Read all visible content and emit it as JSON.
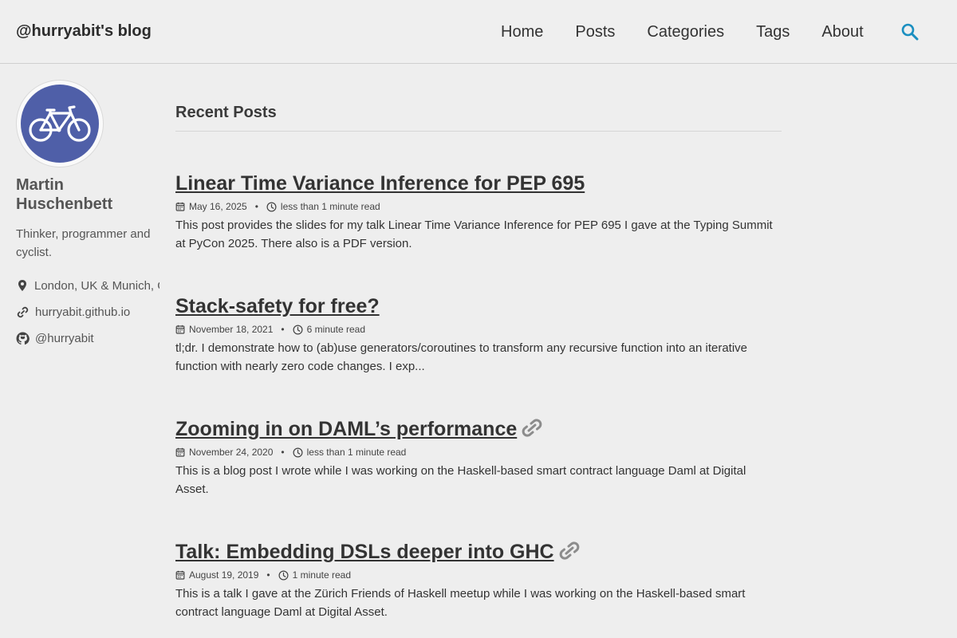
{
  "header": {
    "site_title": "@hurryabit's blog",
    "nav": [
      "Home",
      "Posts",
      "Categories",
      "Tags",
      "About"
    ],
    "accent_color": "#1b8fc0"
  },
  "sidebar": {
    "avatar_icon": "bicycle-icon",
    "author_name": "Martin Huschenbett",
    "bio": "Thinker, programmer and cyclist.",
    "location": "London, UK & Munich, Germany",
    "website": "hurryabit.github.io",
    "github": "@hurryabit"
  },
  "main": {
    "section_title": "Recent Posts",
    "posts": [
      {
        "title": "Linear Time Variance Inference for PEP 695",
        "date": "May 16, 2025",
        "read_time": "less than 1 minute read",
        "excerpt": "This post provides the slides for my talk Linear Time Variance Inference for PEP 695 I gave at the Typing Summit at PyCon 2025. There also is a PDF version.",
        "external": false
      },
      {
        "title": "Stack-safety for free?",
        "date": "November 18, 2021",
        "read_time": "6 minute read",
        "excerpt": "tl;dr. I demonstrate how to (ab)use generators/coroutines to transform any recursive function into an iterative function with nearly zero code changes. I exp...",
        "external": false
      },
      {
        "title": "Zooming in on DAML’s performance",
        "date": "November 24, 2020",
        "read_time": "less than 1 minute read",
        "excerpt": "This is a blog post I wrote while I was working on the Haskell-based smart contract language Daml at Digital Asset.",
        "external": true
      },
      {
        "title": "Talk: Embedding DSLs deeper into GHC",
        "date": "August 19, 2019",
        "read_time": "1 minute read",
        "excerpt": "This is a talk I gave at the Zürich Friends of Haskell meetup while I was working on the Haskell-based smart contract language Daml at Digital Asset.",
        "external": true
      }
    ]
  }
}
